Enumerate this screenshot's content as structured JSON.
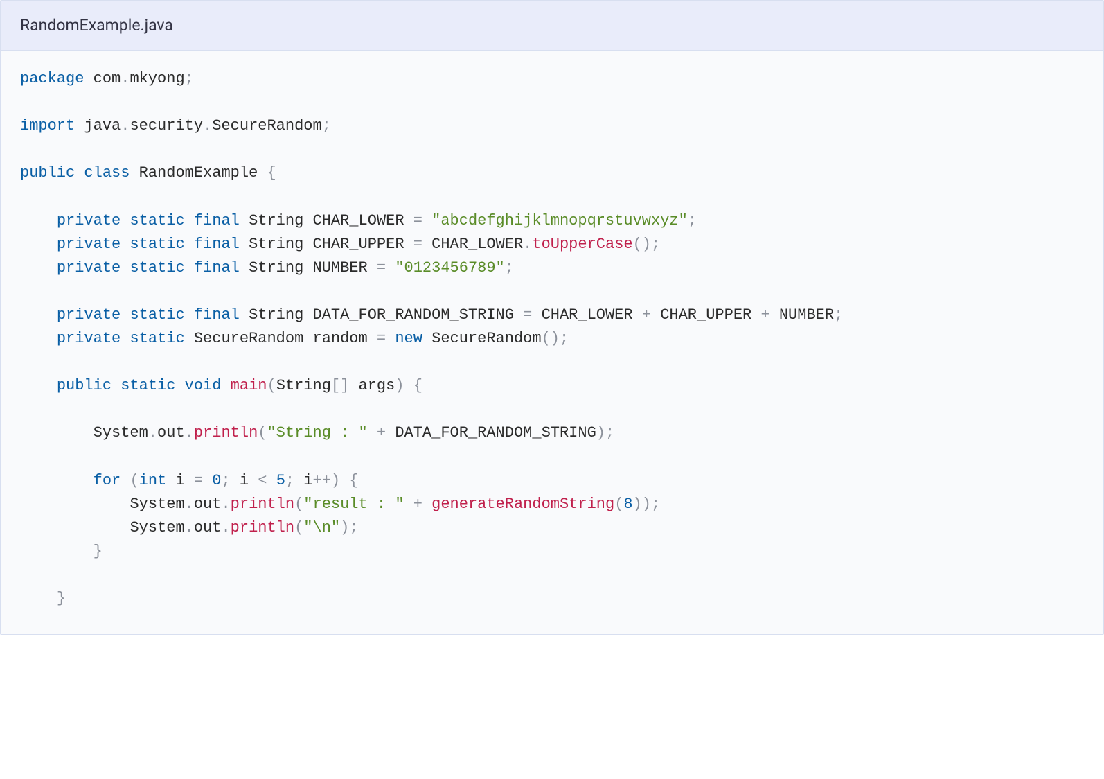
{
  "title": "RandomExample.java",
  "code": {
    "line1": {
      "kw1": "package",
      "pkg1": "com",
      "dot": ".",
      "pkg2": "mkyong",
      "semi": ";"
    },
    "line2": "",
    "line3": {
      "kw1": "import",
      "pkg1": "java",
      "pkg2": "security",
      "pkg3": "SecureRandom",
      "dot": ".",
      "semi": ";"
    },
    "line4": "",
    "line5": {
      "kw1": "public",
      "kw2": "class",
      "name": "RandomExample",
      "brace": "{"
    },
    "line6": "",
    "line7": {
      "indent": "    ",
      "kw1": "private",
      "kw2": "static",
      "kw3": "final",
      "type": "String",
      "name": "CHAR_LOWER",
      "eq": "=",
      "str": "\"abcdefghijklmnopqrstuvwxyz\"",
      "semi": ";"
    },
    "line8": {
      "indent": "    ",
      "kw1": "private",
      "kw2": "static",
      "kw3": "final",
      "type": "String",
      "name": "CHAR_UPPER",
      "eq": "=",
      "ref": "CHAR_LOWER",
      "dot": ".",
      "call": "toUpperCase",
      "parens": "()",
      "semi": ";"
    },
    "line9": {
      "indent": "    ",
      "kw1": "private",
      "kw2": "static",
      "kw3": "final",
      "type": "String",
      "name": "NUMBER",
      "eq": "=",
      "str": "\"0123456789\"",
      "semi": ";"
    },
    "line10": "",
    "line11": {
      "indent": "    ",
      "kw1": "private",
      "kw2": "static",
      "kw3": "final",
      "type": "String",
      "name": "DATA_FOR_RANDOM_STRING",
      "eq": "=",
      "ref1": "CHAR_LOWER",
      "plus": "+",
      "ref2": "CHAR_UPPER",
      "ref3": "NUMBER",
      "semi": ";"
    },
    "line12": {
      "indent": "    ",
      "kw1": "private",
      "kw2": "static",
      "type": "SecureRandom",
      "name": "random",
      "eq": "=",
      "kw3": "new",
      "ctor": "SecureRandom",
      "parens": "()",
      "semi": ";"
    },
    "line13": "",
    "line14": {
      "indent": "    ",
      "kw1": "public",
      "kw2": "static",
      "kw3": "void",
      "call": "main",
      "lp": "(",
      "argtype": "String",
      "brackets": "[]",
      "argname": "args",
      "rp": ")",
      "brace": "{"
    },
    "line15": "",
    "line16": {
      "indent": "        ",
      "sys": "System",
      "dot": ".",
      "out": "out",
      "call": "println",
      "lp": "(",
      "str": "\"String : \"",
      "plus": "+",
      "ref": "DATA_FOR_RANDOM_STRING",
      "rp": ")",
      "semi": ";"
    },
    "line17": "",
    "line18": {
      "indent": "        ",
      "kw1": "for",
      "lp": "(",
      "kw2": "int",
      "var": "i",
      "eq": "=",
      "n0": "0",
      "semi1": ";",
      "var2": "i",
      "lt": "<",
      "n5": "5",
      "semi2": ";",
      "var3": "i",
      "inc": "++",
      "rp": ")",
      "brace": "{"
    },
    "line19": {
      "indent": "            ",
      "sys": "System",
      "dot": ".",
      "out": "out",
      "call": "println",
      "lp": "(",
      "str": "\"result : \"",
      "plus": "+",
      "call2": "generateRandomString",
      "lp2": "(",
      "n8": "8",
      "rp2": ")",
      "rp": ")",
      "semi": ";"
    },
    "line20": {
      "indent": "            ",
      "sys": "System",
      "dot": ".",
      "out": "out",
      "call": "println",
      "lp": "(",
      "str": "\"\\n\"",
      "rp": ")",
      "semi": ";"
    },
    "line21": {
      "indent": "        ",
      "brace": "}"
    },
    "line22": "",
    "line23": {
      "indent": "    ",
      "brace": "}"
    }
  }
}
